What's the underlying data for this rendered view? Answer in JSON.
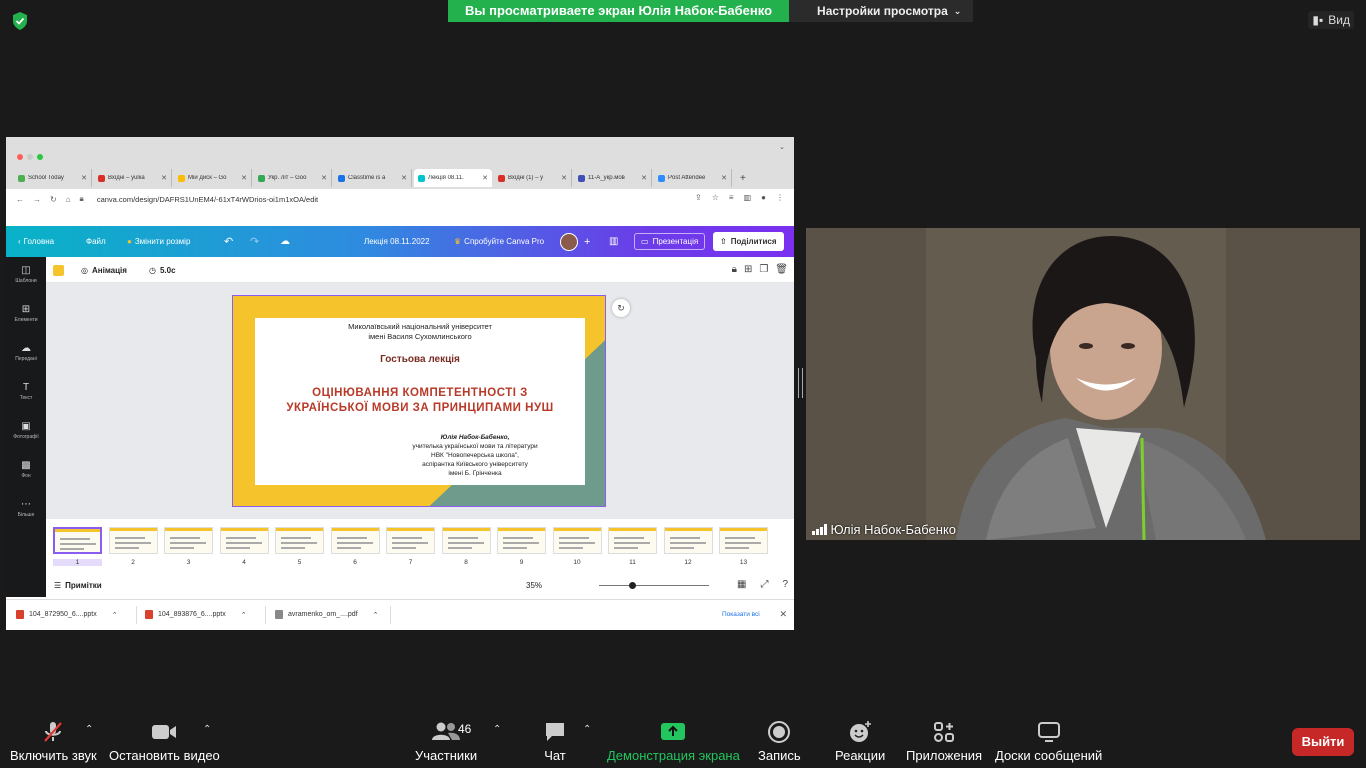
{
  "banner": {
    "sharing_text": "Вы просматриваете экран Юлія Набок-Бабенко",
    "view_options": "Настройки просмотра",
    "view_label": "Вид"
  },
  "browser": {
    "tabs": [
      {
        "label": "School Today",
        "color": "#4caf50"
      },
      {
        "label": "Вхідні – yuliia",
        "color": "#d93025"
      },
      {
        "label": "Мій диск – Go",
        "color": "#fbbc04"
      },
      {
        "label": "Укр. літ – Goo",
        "color": "#34a853"
      },
      {
        "label": "Classtime is a",
        "color": "#1a73e8"
      },
      {
        "label": "Лекція 08.11.",
        "color": "#00c4cc"
      },
      {
        "label": "Вхідні (1) – y",
        "color": "#d93025"
      },
      {
        "label": "11-А_укр.мов",
        "color": "#3f51b5"
      },
      {
        "label": "Post Attendee",
        "color": "#2d8cff"
      }
    ],
    "url": "canva.com/design/DAFRS1UnEM4/-61xT4rWDrios-oi1m1xOA/edit"
  },
  "canva": {
    "home": "Головна",
    "file": "Файл",
    "resize": "Змінити розмір",
    "doc_title": "Лекція 08.11.2022",
    "try_pro": "Спробуйте Canva Pro",
    "present": "Презентація",
    "share": "Поділитися",
    "animation": "Анімація",
    "duration": "5.0с",
    "sidebar": [
      "Шаблони",
      "Елементи",
      "Передані",
      "Текст",
      "Фотографії",
      "Фон",
      "Більше"
    ],
    "notes": "Примітки",
    "zoom": "35%",
    "thumb_numbers": [
      "1",
      "2",
      "3",
      "4",
      "5",
      "6",
      "7",
      "8",
      "9",
      "10",
      "11",
      "12",
      "13"
    ]
  },
  "slide": {
    "univ1": "Миколаївський національний університет",
    "univ2": "імені Василя Сухомлинського",
    "guest": "Гостьова лекція",
    "title1": "ОЦІНЮВАННЯ КОМПЕТЕНТНОСТІ З",
    "title2": "УКРАЇНСЬКОЇ МОВИ ЗА ПРИНЦИПАМИ НУШ",
    "author": "Юлія Набок-Бабенко,",
    "a1": "учителька української мови та літератури",
    "a2": "НВК \"Новопечерська школа\",",
    "a3": "аспірантка Київського університету",
    "a4": "імені Б. Грінченка"
  },
  "downloads": {
    "items": [
      "104_872950_6....pptx",
      "104_893876_6....pptx",
      "avramenko_om_....pdf"
    ],
    "show_all": "Показати всі"
  },
  "video": {
    "name": "Юлія Набок-Бабенко"
  },
  "toolbar": {
    "mute": "Включить звук",
    "video": "Остановить видео",
    "participants": "Участники",
    "participants_count": "46",
    "chat": "Чат",
    "share": "Демонстрация экрана",
    "record": "Запись",
    "reactions": "Реакции",
    "apps": "Приложения",
    "whiteboards": "Доски сообщений",
    "leave": "Выйти"
  }
}
